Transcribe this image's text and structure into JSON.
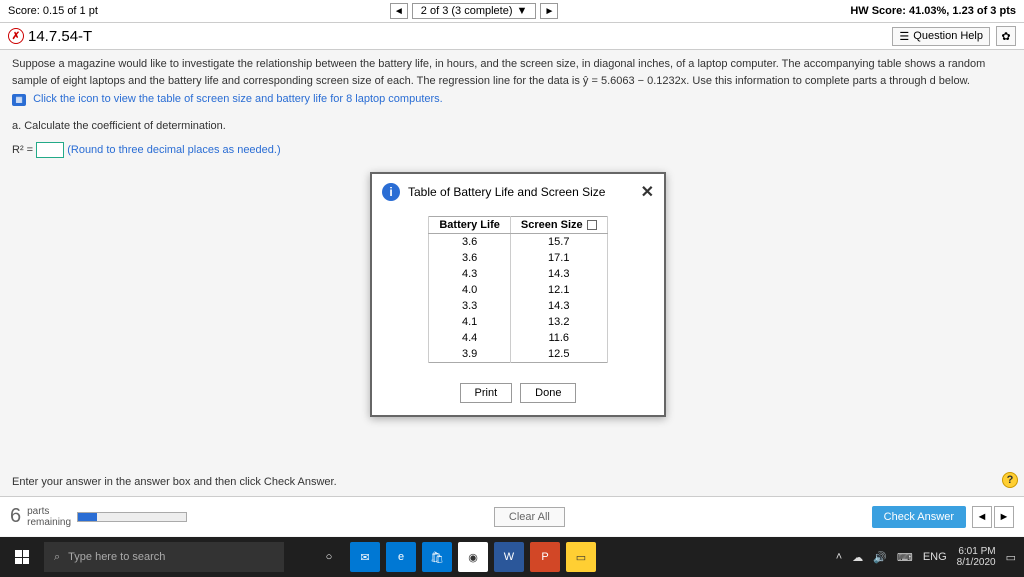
{
  "topbar": {
    "score_label": "Score: 0.15 of 1 pt",
    "progress": "2 of 3 (3 complete)",
    "hw_score": "HW Score: 41.03%, 1.23 of 3 pts"
  },
  "header": {
    "question_id": "14.7.54-T",
    "help_label": "Question Help"
  },
  "problem": {
    "intro": "Suppose a magazine would like to investigate the relationship between the battery life, in hours, and the screen size, in diagonal inches, of a laptop computer. The accompanying table shows a random sample of eight laptops and the battery life and corresponding screen size of each. The regression line for the data is ŷ = 5.6063 − 0.1232x. Use this information to complete parts a through d below.",
    "click_icon": "Click the icon to view the table of screen size and battery life for 8 laptop computers.",
    "part_a": "a. Calculate the coefficient of determination.",
    "r2_prefix": "R² =",
    "round_note": "(Round to three decimal places as needed.)"
  },
  "modal": {
    "title": "Table of Battery Life and Screen Size",
    "col1": "Battery Life",
    "col2": "Screen Size",
    "rows": [
      {
        "bl": "3.6",
        "ss": "15.7"
      },
      {
        "bl": "3.6",
        "ss": "17.1"
      },
      {
        "bl": "4.3",
        "ss": "14.3"
      },
      {
        "bl": "4.0",
        "ss": "12.1"
      },
      {
        "bl": "3.3",
        "ss": "14.3"
      },
      {
        "bl": "4.1",
        "ss": "13.2"
      },
      {
        "bl": "4.4",
        "ss": "11.6"
      },
      {
        "bl": "3.9",
        "ss": "12.5"
      }
    ],
    "print": "Print",
    "done": "Done"
  },
  "footer": {
    "instruction": "Enter your answer in the answer box and then click Check Answer.",
    "parts_num": "6",
    "parts_label": "parts\nremaining",
    "clear": "Clear All",
    "check": "Check Answer"
  },
  "taskbar": {
    "search_placeholder": "Type here to search",
    "time": "6:01 PM",
    "date": "8/1/2020",
    "lang": "ENG"
  }
}
